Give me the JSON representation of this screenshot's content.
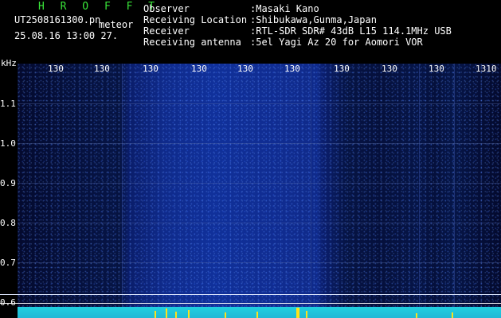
{
  "header": {
    "brand": "H R O F F T",
    "filename": "UT2508161300.pn",
    "mode": "meteor",
    "datetime": "25.08.16 13:00    27.",
    "info": [
      {
        "key": "Observer",
        "value": ":Masaki Kano"
      },
      {
        "key": "Receiving Location",
        "value": ":Shibukawa,Gunma,Japan"
      },
      {
        "key": "Receiver",
        "value": ":RTL-SDR SDR# 43dB L15 114.1MHz USB"
      },
      {
        "key": "Receiving antenna",
        "value": ":5el Yagi Az 20 for Aomori VOR"
      }
    ]
  },
  "axis": {
    "unit": "kHz",
    "left_ticks": [
      "1.1",
      "1.0",
      "0.9",
      "0.8",
      "0.7",
      "0.6"
    ],
    "top_ticks": [
      "130",
      "130",
      "130",
      "130",
      "130",
      "130",
      "130",
      "130",
      "130",
      "1310"
    ]
  },
  "colors": {
    "brand": "#39e539",
    "spectrum": "#1fd0e0",
    "spike": "#ffe21a"
  }
}
